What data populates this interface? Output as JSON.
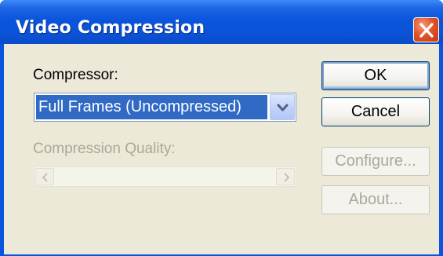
{
  "window": {
    "title": "Video Compression"
  },
  "compressor": {
    "label": "Compressor:",
    "selected": "Full Frames (Uncompressed)"
  },
  "quality": {
    "label": "Compression Quality:",
    "enabled": false
  },
  "buttons": {
    "ok": "OK",
    "cancel": "Cancel",
    "configure": "Configure...",
    "about": "About..."
  },
  "icons": {
    "close": "close-icon",
    "dropdown": "chevron-down-icon",
    "scroll_left": "arrow-left-icon",
    "scroll_right": "arrow-right-icon"
  },
  "colors": {
    "titlebar": "#0a54e0",
    "close_button": "#e2552a",
    "dialog_face": "#ece9d8",
    "selection": "#316ac5",
    "disabled_text": "#aca899"
  }
}
